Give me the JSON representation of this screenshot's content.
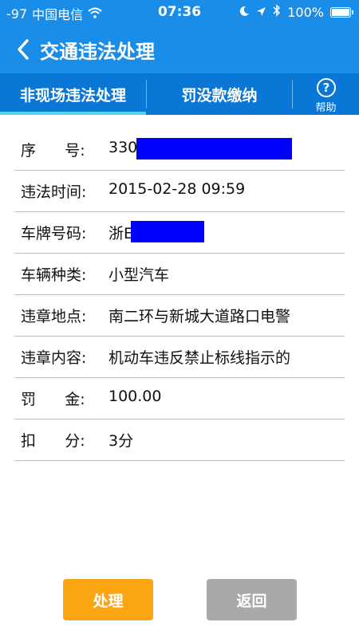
{
  "status_bar": {
    "signal": "-97",
    "carrier": "中国电信",
    "time": "07:36",
    "battery": "100%"
  },
  "nav": {
    "title": "交通违法处理"
  },
  "tabs": {
    "items": [
      {
        "label": "非现场违法处理",
        "active": true
      },
      {
        "label": "罚没款缴纳",
        "active": false
      }
    ],
    "help_label": "帮助",
    "help_symbol": "?"
  },
  "details": [
    {
      "label": "序      号:",
      "value": "330"
    },
    {
      "label": "违法时间:",
      "value": "2015-02-28 09:59"
    },
    {
      "label": "车牌号码:",
      "value": "浙E"
    },
    {
      "label": "车辆种类:",
      "value": "小型汽车"
    },
    {
      "label": "违章地点:",
      "value": "南二环与新城大道路口电警"
    },
    {
      "label": "违章内容:",
      "value": "机动车违反禁止标线指示的"
    },
    {
      "label": "罚      金:",
      "value": "100.00"
    },
    {
      "label": "扣      分:",
      "value": "3分"
    }
  ],
  "buttons": {
    "process": "处理",
    "back": "返回"
  },
  "colors": {
    "primary": "#1a8de8",
    "tab_bar": "#0a76d6",
    "tab_indicator": "#4fd3f0",
    "process_button": "#fca512",
    "back_button": "#a9a9a9",
    "redaction": "#0000ff"
  }
}
